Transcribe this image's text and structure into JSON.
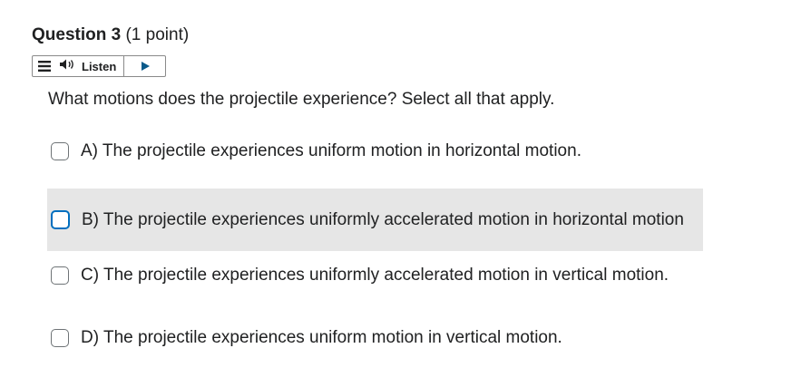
{
  "question": {
    "title": "Question 3",
    "points": "(1 point)",
    "prompt": "What motions does the projectile experience? Select all that apply."
  },
  "readspeaker": {
    "menu_icon": "menu-icon",
    "speaker_icon": "speaker-icon",
    "listen_label": "Listen",
    "play_icon": "play-icon"
  },
  "options": [
    {
      "label": "A) The projectile experiences uniform motion in horizontal motion.",
      "checked": false
    },
    {
      "label": "B) The projectile experiences uniformly accelerated motion in horizontal motion",
      "checked": false,
      "hovered": true
    },
    {
      "label": "C) The projectile experiences uniformly accelerated motion in vertical motion.",
      "checked": false
    },
    {
      "label": "D) The projectile experiences uniform motion in vertical motion.",
      "checked": false
    }
  ],
  "colors": {
    "text": "#202122",
    "hover_background": "#e6e6e6",
    "focus_border": "#006fbf",
    "play_icon": "#0a5a8a"
  }
}
